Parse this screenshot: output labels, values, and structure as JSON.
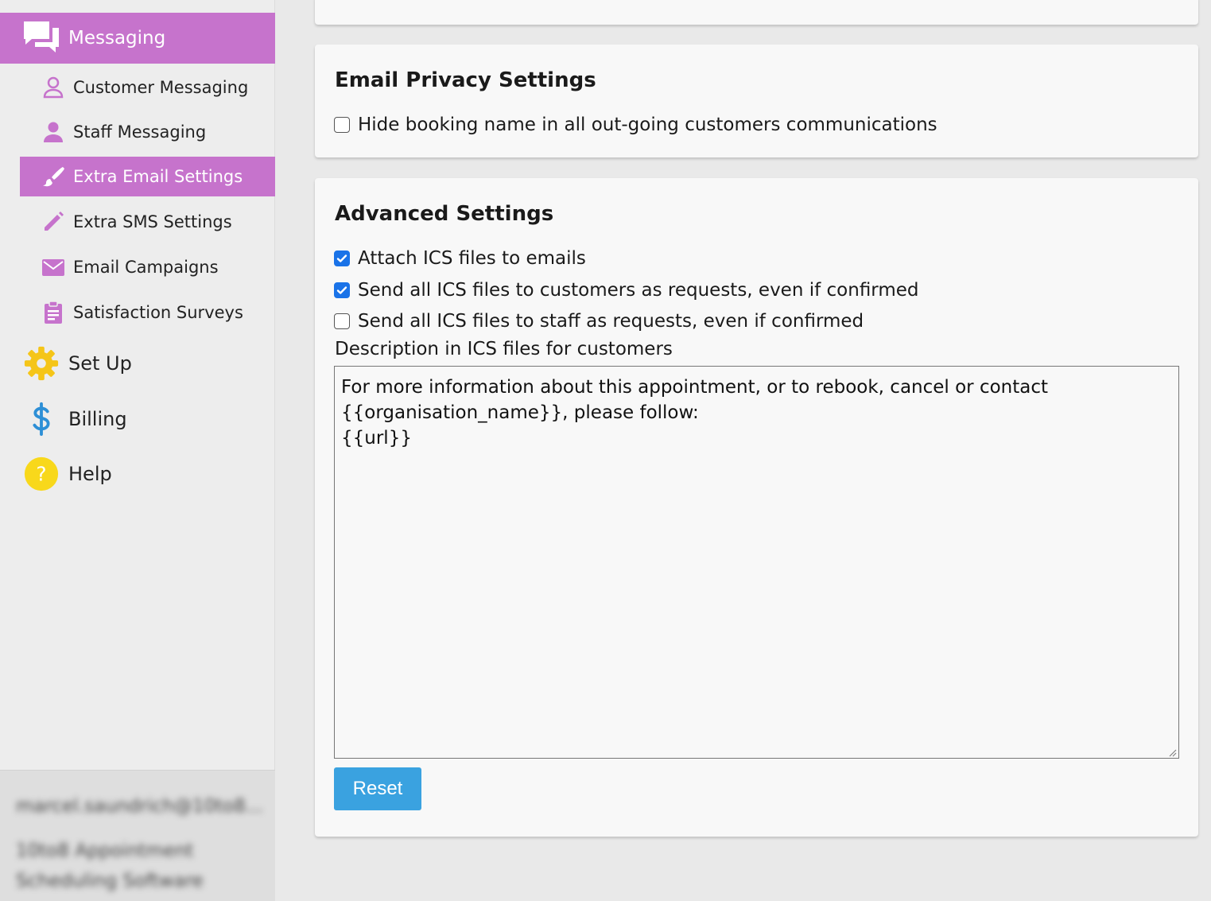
{
  "sidebar": {
    "section": {
      "label": "Messaging",
      "icon": "chat-bubbles-icon"
    },
    "sub_items": [
      {
        "label": "Customer Messaging",
        "icon": "person-outline-icon",
        "active": false
      },
      {
        "label": "Staff Messaging",
        "icon": "person-icon",
        "active": false
      },
      {
        "label": "Extra Email Settings",
        "icon": "brush-icon",
        "active": true
      },
      {
        "label": "Extra SMS Settings",
        "icon": "pencil-icon",
        "active": false
      },
      {
        "label": "Email Campaigns",
        "icon": "envelope-icon",
        "active": false
      },
      {
        "label": "Satisfaction Surveys",
        "icon": "clipboard-icon",
        "active": false
      }
    ],
    "top_items": [
      {
        "label": "Set Up",
        "icon": "gear-icon"
      },
      {
        "label": "Billing",
        "icon": "dollar-icon"
      },
      {
        "label": "Help",
        "icon": "question-icon"
      }
    ],
    "user": {
      "email": "marcel.saundrich@10to8...",
      "org": "10to8 Appointment Scheduling Software"
    }
  },
  "privacy": {
    "title": "Email Privacy Settings",
    "options": [
      {
        "label": "Hide booking name in all out-going customers communications",
        "checked": false
      }
    ]
  },
  "advanced": {
    "title": "Advanced Settings",
    "options": [
      {
        "label": "Attach ICS files to emails",
        "checked": true
      },
      {
        "label": "Send all ICS files to customers as requests, even if confirmed",
        "checked": true
      },
      {
        "label": "Send all ICS files to staff as requests, even if confirmed",
        "checked": false
      }
    ],
    "description_label": "Description in ICS files for customers",
    "description_value": "For more information about this appointment, or to rebook, cancel or contact\n{{organisation_name}}, please follow:\n{{url}}",
    "reset_label": "Reset"
  },
  "colors": {
    "accent": "#c673cc",
    "button": "#3aa2e0",
    "checkbox": "#1a73e8",
    "gear": "#f5c518",
    "dollar": "#2d8fd6",
    "help": "#f8d81b"
  }
}
